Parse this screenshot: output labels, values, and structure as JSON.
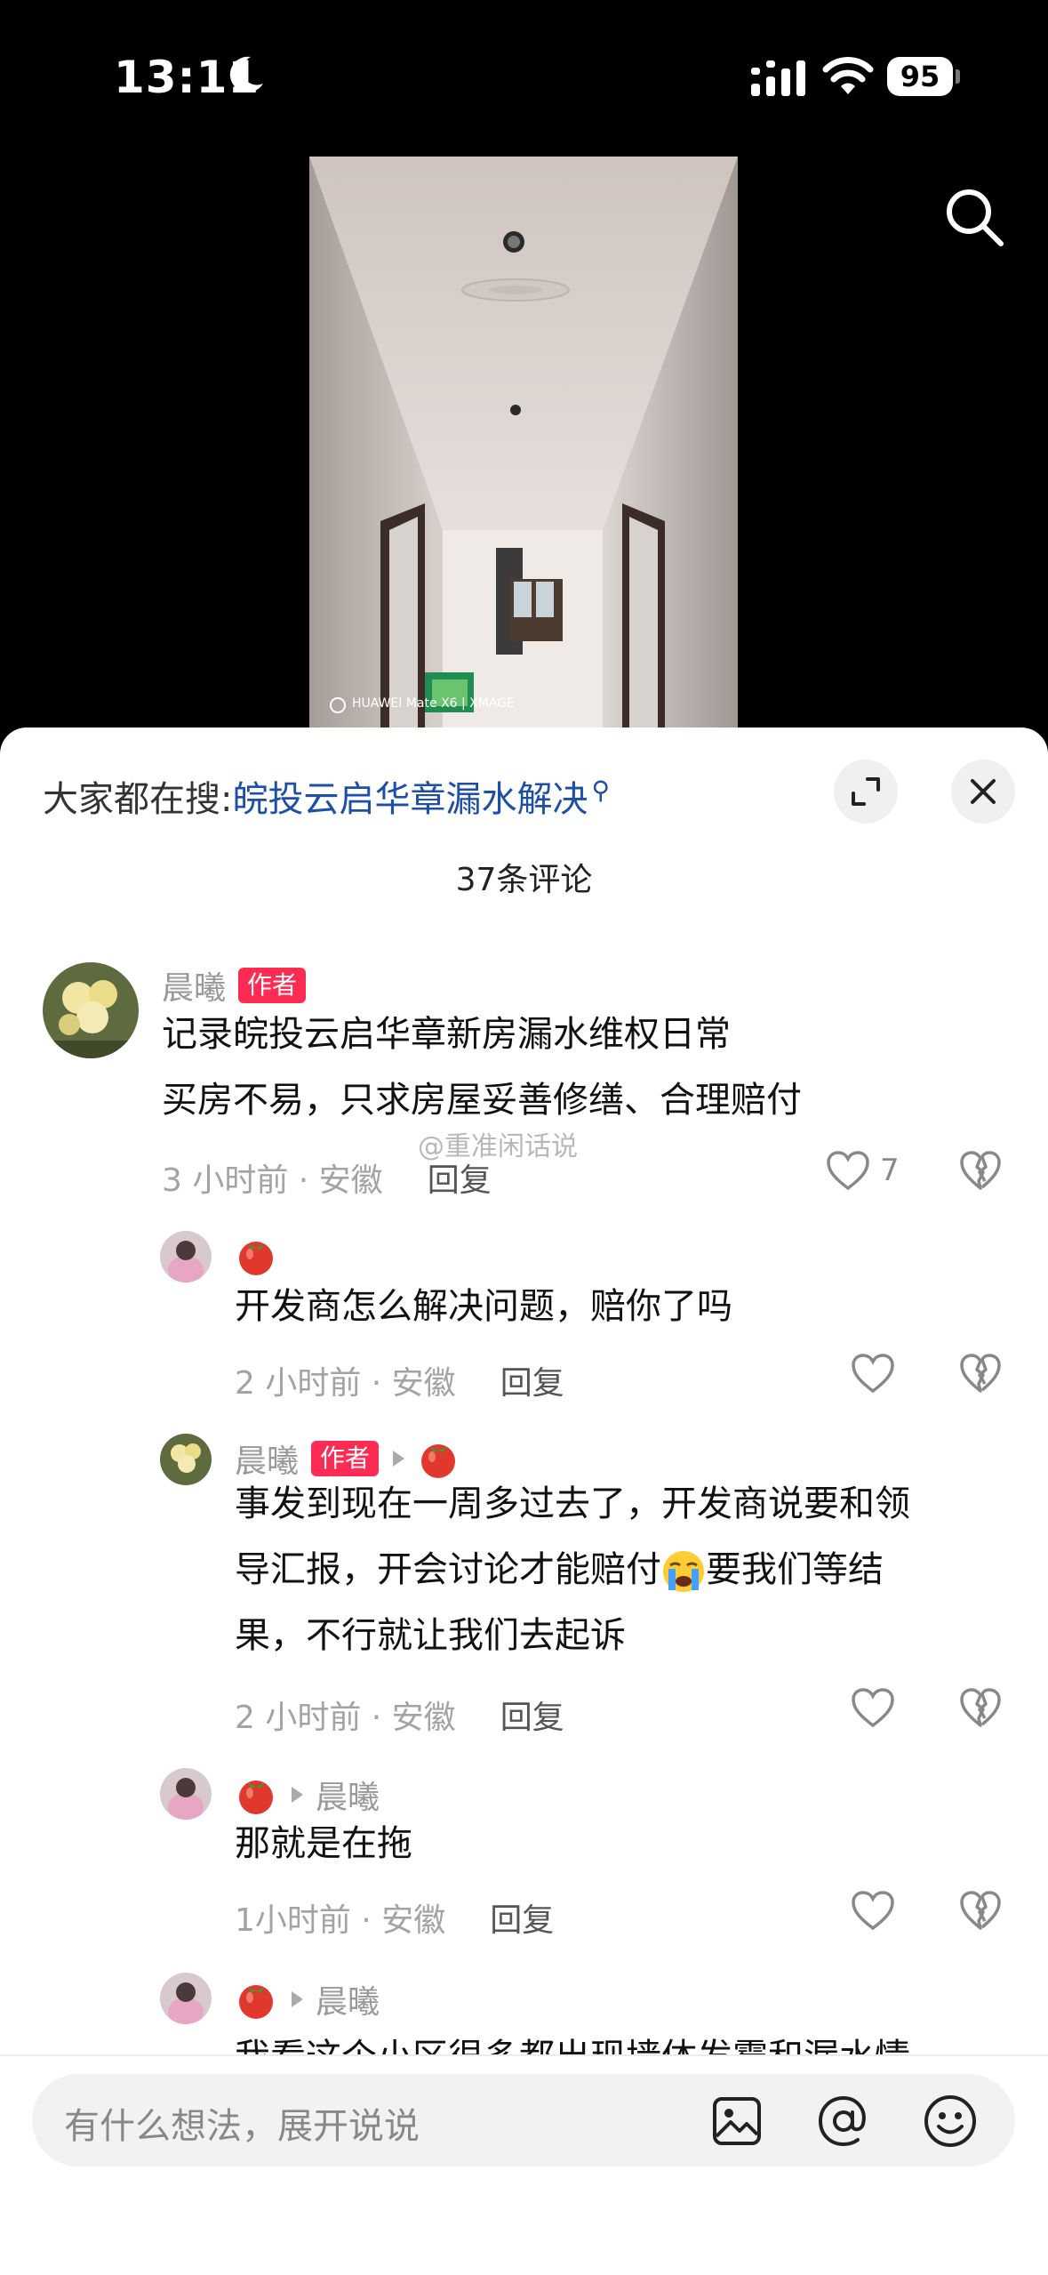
{
  "status_bar": {
    "time": "13:11",
    "battery": "95"
  },
  "video": {
    "watermark": "HUAWEI Mate X6 | XMAGE"
  },
  "hot_search": {
    "label": "大家都在搜:",
    "term": "皖投云启华章漏水解决"
  },
  "comments_count": "37条评论",
  "comments": [
    {
      "user": "晨曦",
      "badge": "作者",
      "lines": [
        "记录皖投云启华章新房漏水维权日常",
        "买房不易，只求房屋妥善修缮、合理赔付"
      ],
      "time_loc": "3 小时前 · 安徽",
      "reply": "回复",
      "likes": "7"
    },
    {
      "user": "🍅",
      "lines": [
        "开发商怎么解决问题，赔你了吗"
      ],
      "time_loc": "2 小时前 · 安徽",
      "reply": "回复"
    },
    {
      "user": "晨曦",
      "badge": "作者",
      "reply_to": "🍅",
      "lines": [
        "事发到现在一周多过去了，开发商说要和领",
        "导汇报，开会讨论才能赔付",
        "果，不行就让我们去起诉"
      ],
      "inline_after_emoji": "要我们等结",
      "time_loc": "2 小时前 · 安徽",
      "reply": "回复"
    },
    {
      "user": "🍅",
      "reply_to": "晨曦",
      "lines": [
        "那就是在拖"
      ],
      "time_loc": "1小时前 · 安徽",
      "reply": "回复"
    },
    {
      "user": "🍅",
      "reply_to": "晨曦",
      "lines": [
        "我看这个小区很多都出现墙体发霉和漏水情"
      ]
    }
  ],
  "watermark": "@重准闲话说",
  "input": {
    "placeholder": "有什么想法，展开说说"
  },
  "colors": {
    "accent": "#fe2c55",
    "link": "#1e4fa6"
  }
}
